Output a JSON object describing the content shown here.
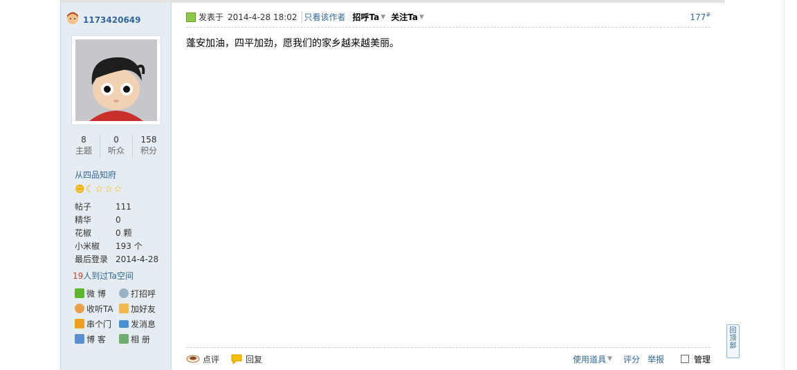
{
  "author": {
    "name": "1173420649"
  },
  "stats": [
    {
      "num": "8",
      "label": "主题"
    },
    {
      "num": "0",
      "label": "听众"
    },
    {
      "num": "158",
      "label": "积分"
    }
  ],
  "rank": "从四品知府",
  "info": [
    {
      "k": "帖子",
      "v": "111"
    },
    {
      "k": "精华",
      "v": "0"
    },
    {
      "k": "花椒",
      "v": "0 颗"
    },
    {
      "k": "小米椒",
      "v": "193 个"
    },
    {
      "k": "最后登录",
      "v": "2014-4-28"
    }
  ],
  "visitors": {
    "count": "19",
    "text": "人到过Ta空间"
  },
  "actions": [
    "微 博",
    "打招呼",
    "收听TA",
    "加好友",
    "串个门",
    "发消息",
    "博 客",
    "相 册"
  ],
  "post": {
    "posted_label": "发表于",
    "datetime": "2014-4-28 18:02",
    "only_author": "只看该作者",
    "greet": "招呼Ta",
    "follow": "关注Ta",
    "floor": "177",
    "floor_suffix": "#",
    "content": "蓬安加油，四平加劲，愿我们的家乡越来越美丽。"
  },
  "footer": {
    "comment": "点评",
    "reply": "回复",
    "tools": "使用道具",
    "rate": "评分",
    "report": "举报",
    "manage": "管理"
  },
  "to_top": [
    "回",
    "顶",
    "部"
  ],
  "icons": {
    "star": "star-icon",
    "sun": "sun-icon",
    "moon": "moon-icon",
    "weibo": "weibo-icon",
    "greet": "greet-icon",
    "follow": "follow-icon",
    "friend": "handshake-icon",
    "home": "home-icon",
    "mail": "mail-icon",
    "blog": "blog-icon",
    "album": "album-icon"
  },
  "colors": {
    "link": "#336699",
    "sidebar_bg": "#e5edf2",
    "visitor_count": "#c4432a"
  }
}
